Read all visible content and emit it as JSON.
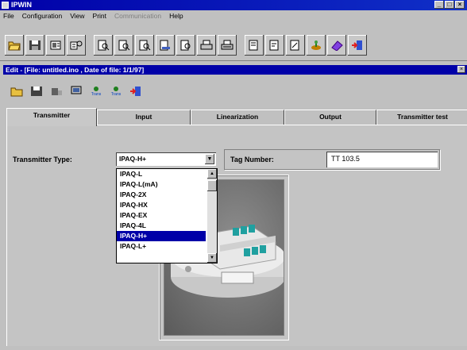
{
  "window": {
    "title": "IPWIN",
    "controls": [
      "_",
      "□",
      "×"
    ]
  },
  "menu": {
    "items": [
      {
        "label": "File",
        "enabled": true
      },
      {
        "label": "Configuration",
        "enabled": true
      },
      {
        "label": "View",
        "enabled": true
      },
      {
        "label": "Print",
        "enabled": true
      },
      {
        "label": "Communication",
        "enabled": false
      },
      {
        "label": "Help",
        "enabled": true
      }
    ]
  },
  "toolbar_main": {
    "buttons": [
      "open-folder-icon",
      "disk-icon",
      "transmitter-read-icon",
      "transmitter-write-icon",
      "document-search-icon",
      "document-search-2-icon",
      "document-search-3-icon",
      "document-edit-icon",
      "document-search-4-icon",
      "printer-icon",
      "printer-preview-icon",
      "document-a-icon",
      "document-b-icon",
      "document-c-icon",
      "plant-icon",
      "eraser-icon",
      "exit-door-icon"
    ]
  },
  "child_window": {
    "title": "Edit - [File: untitled.ino , Date of file: 1/1/97]",
    "close": "×",
    "toolbar": {
      "buttons": [
        "open-folder-icon",
        "disk-icon",
        "transmitter-icon",
        "computer-icon",
        "info-icon",
        "info-2-icon",
        "exit-door-icon"
      ],
      "small_labels": [
        "Trans",
        "Trans"
      ]
    }
  },
  "tabs": [
    {
      "label": "Transmitter",
      "active": true
    },
    {
      "label": "Input",
      "active": false
    },
    {
      "label": "Linearization",
      "active": false
    },
    {
      "label": "Output",
      "active": false
    },
    {
      "label": "Transmitter test",
      "active": false
    }
  ],
  "form": {
    "transmitter_type_label": "Transmitter Type:",
    "transmitter_type_value": "IPAQ-H+",
    "tag_number_label": "Tag Number:",
    "tag_number_value": "TT 103.5"
  },
  "dropdown": {
    "options": [
      "IPAQ-L",
      "IPAQ-L(mA)",
      "IPAQ-2X",
      "IPAQ-HX",
      "IPAQ-EX",
      "IPAQ-4L",
      "IPAQ-H+",
      "IPAQ-L+"
    ],
    "selected": "IPAQ-H+"
  },
  "colors": {
    "title_bar": "#0000a8",
    "selection": "#0000a8",
    "face": "#c0c0c0"
  }
}
